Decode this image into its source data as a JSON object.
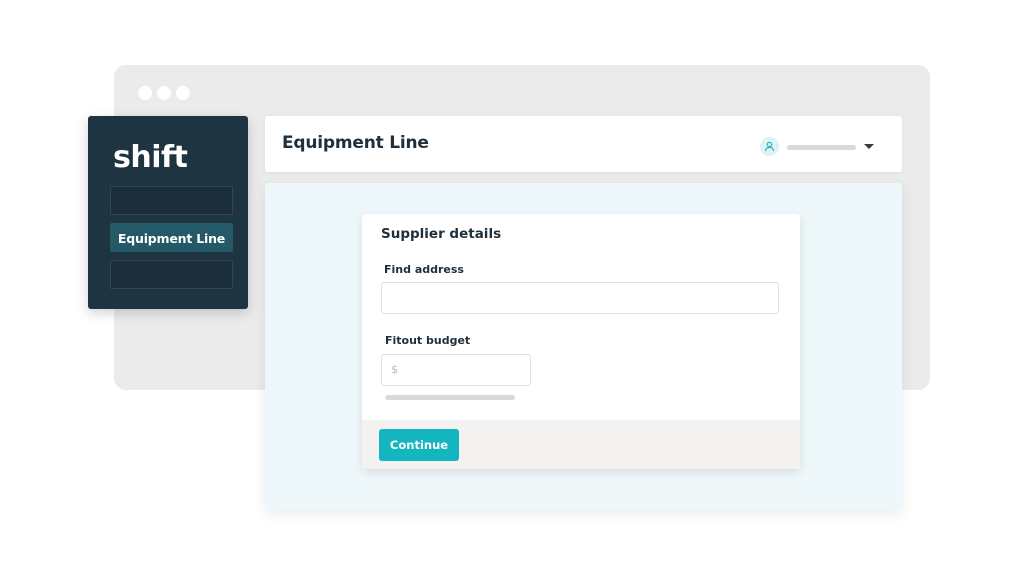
{
  "brand": {
    "logo_text": "shift"
  },
  "sidebar": {
    "items": [
      {
        "label": ""
      },
      {
        "label": "Equipment Line"
      },
      {
        "label": ""
      }
    ]
  },
  "header": {
    "title": "Equipment Line",
    "user_icon": "user-icon",
    "menu_icon": "caret-down-icon"
  },
  "form": {
    "title": "Supplier details",
    "address": {
      "label": "Find address",
      "value": ""
    },
    "budget": {
      "label": "Fitout budget",
      "currency_symbol": "$",
      "value": ""
    },
    "continue_label": "Continue"
  },
  "colors": {
    "accent": "#13b5bf",
    "sidebar": "#1e3441",
    "active_nav": "#245968",
    "content_bg": "#eef7f9"
  }
}
